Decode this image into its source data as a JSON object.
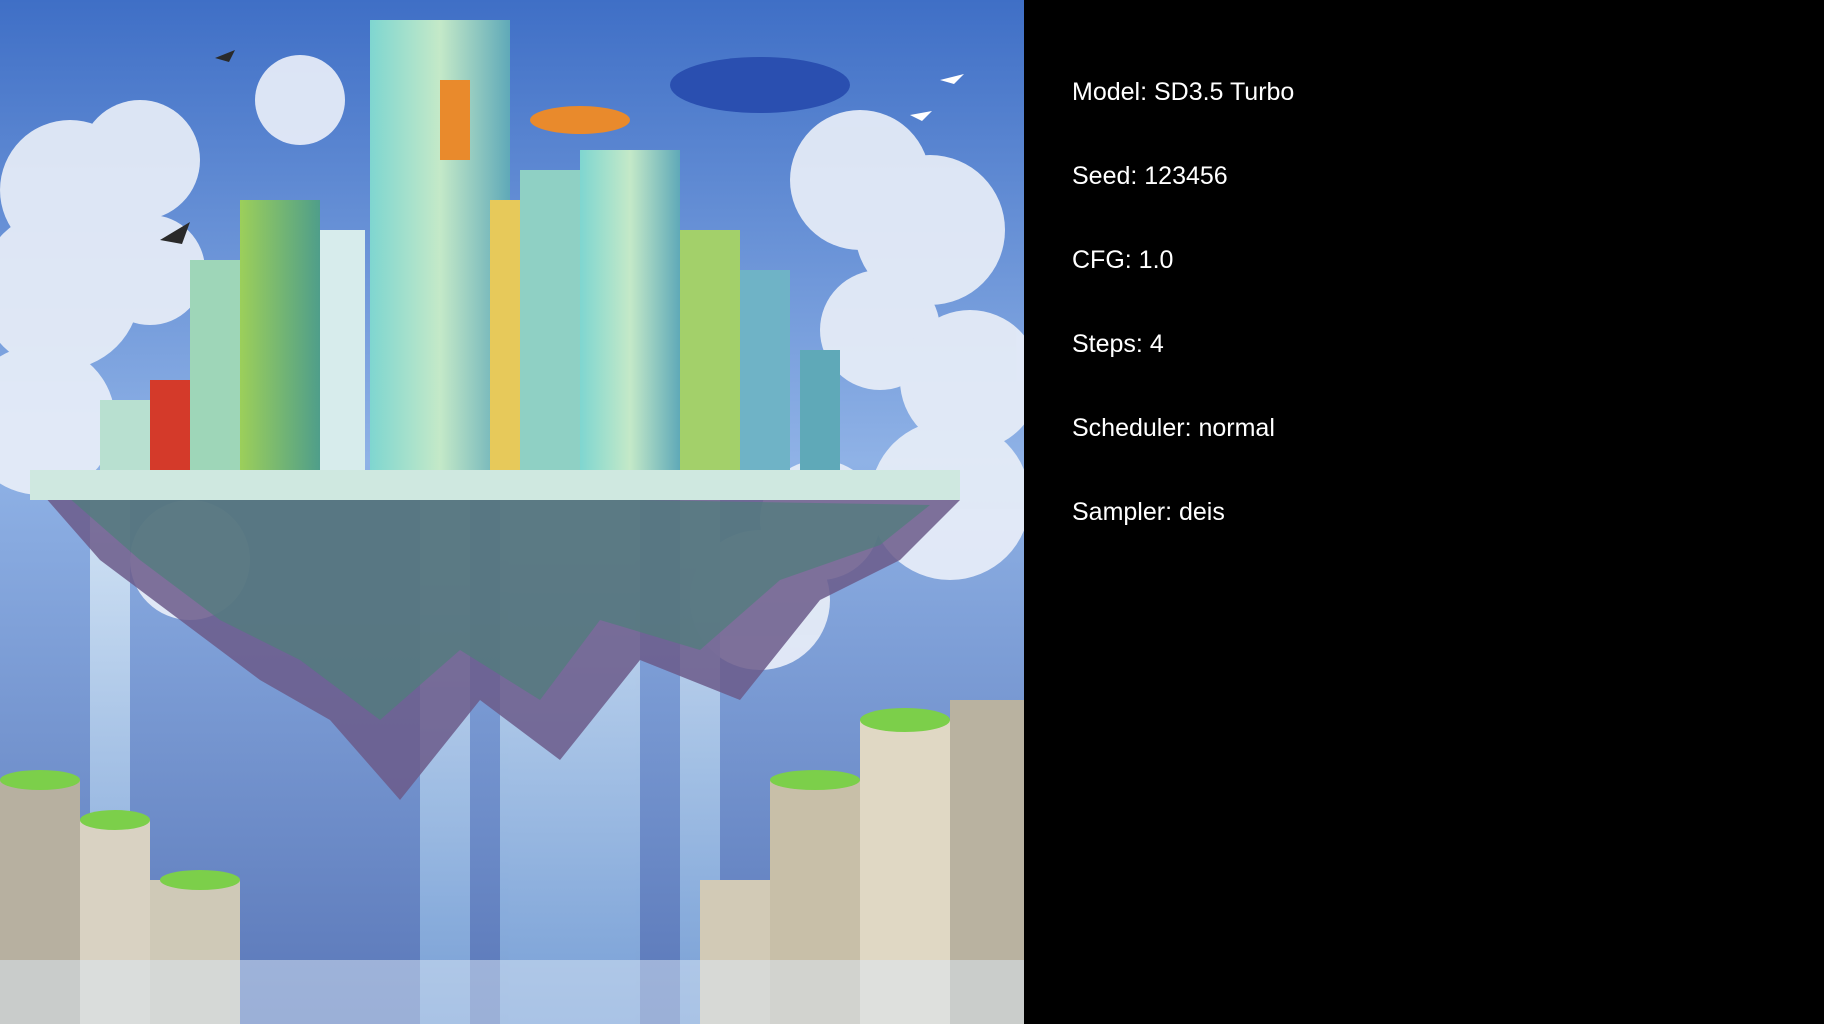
{
  "image": {
    "subject": "floating-city-artwork-icon",
    "palette": {
      "sky": "#4a78c8",
      "cloud": "#e8eef8",
      "glass_cyan": "#7fd6d0",
      "glass_green": "#9ccf5a",
      "accent_orange": "#e98a2c",
      "accent_red": "#d43a2a",
      "water": "#cfe3f5",
      "shadow": "#1d2a55"
    }
  },
  "info": {
    "model_label": "Model: SD3.5 Turbo",
    "seed_label": "Seed: 123456",
    "cfg_label": "CFG: 1.0",
    "steps_label": "Steps: 4",
    "scheduler_label": "Scheduler: normal",
    "sampler_label": "Sampler: deis"
  },
  "colors": {
    "background": "#000000",
    "text": "#ffffff"
  }
}
